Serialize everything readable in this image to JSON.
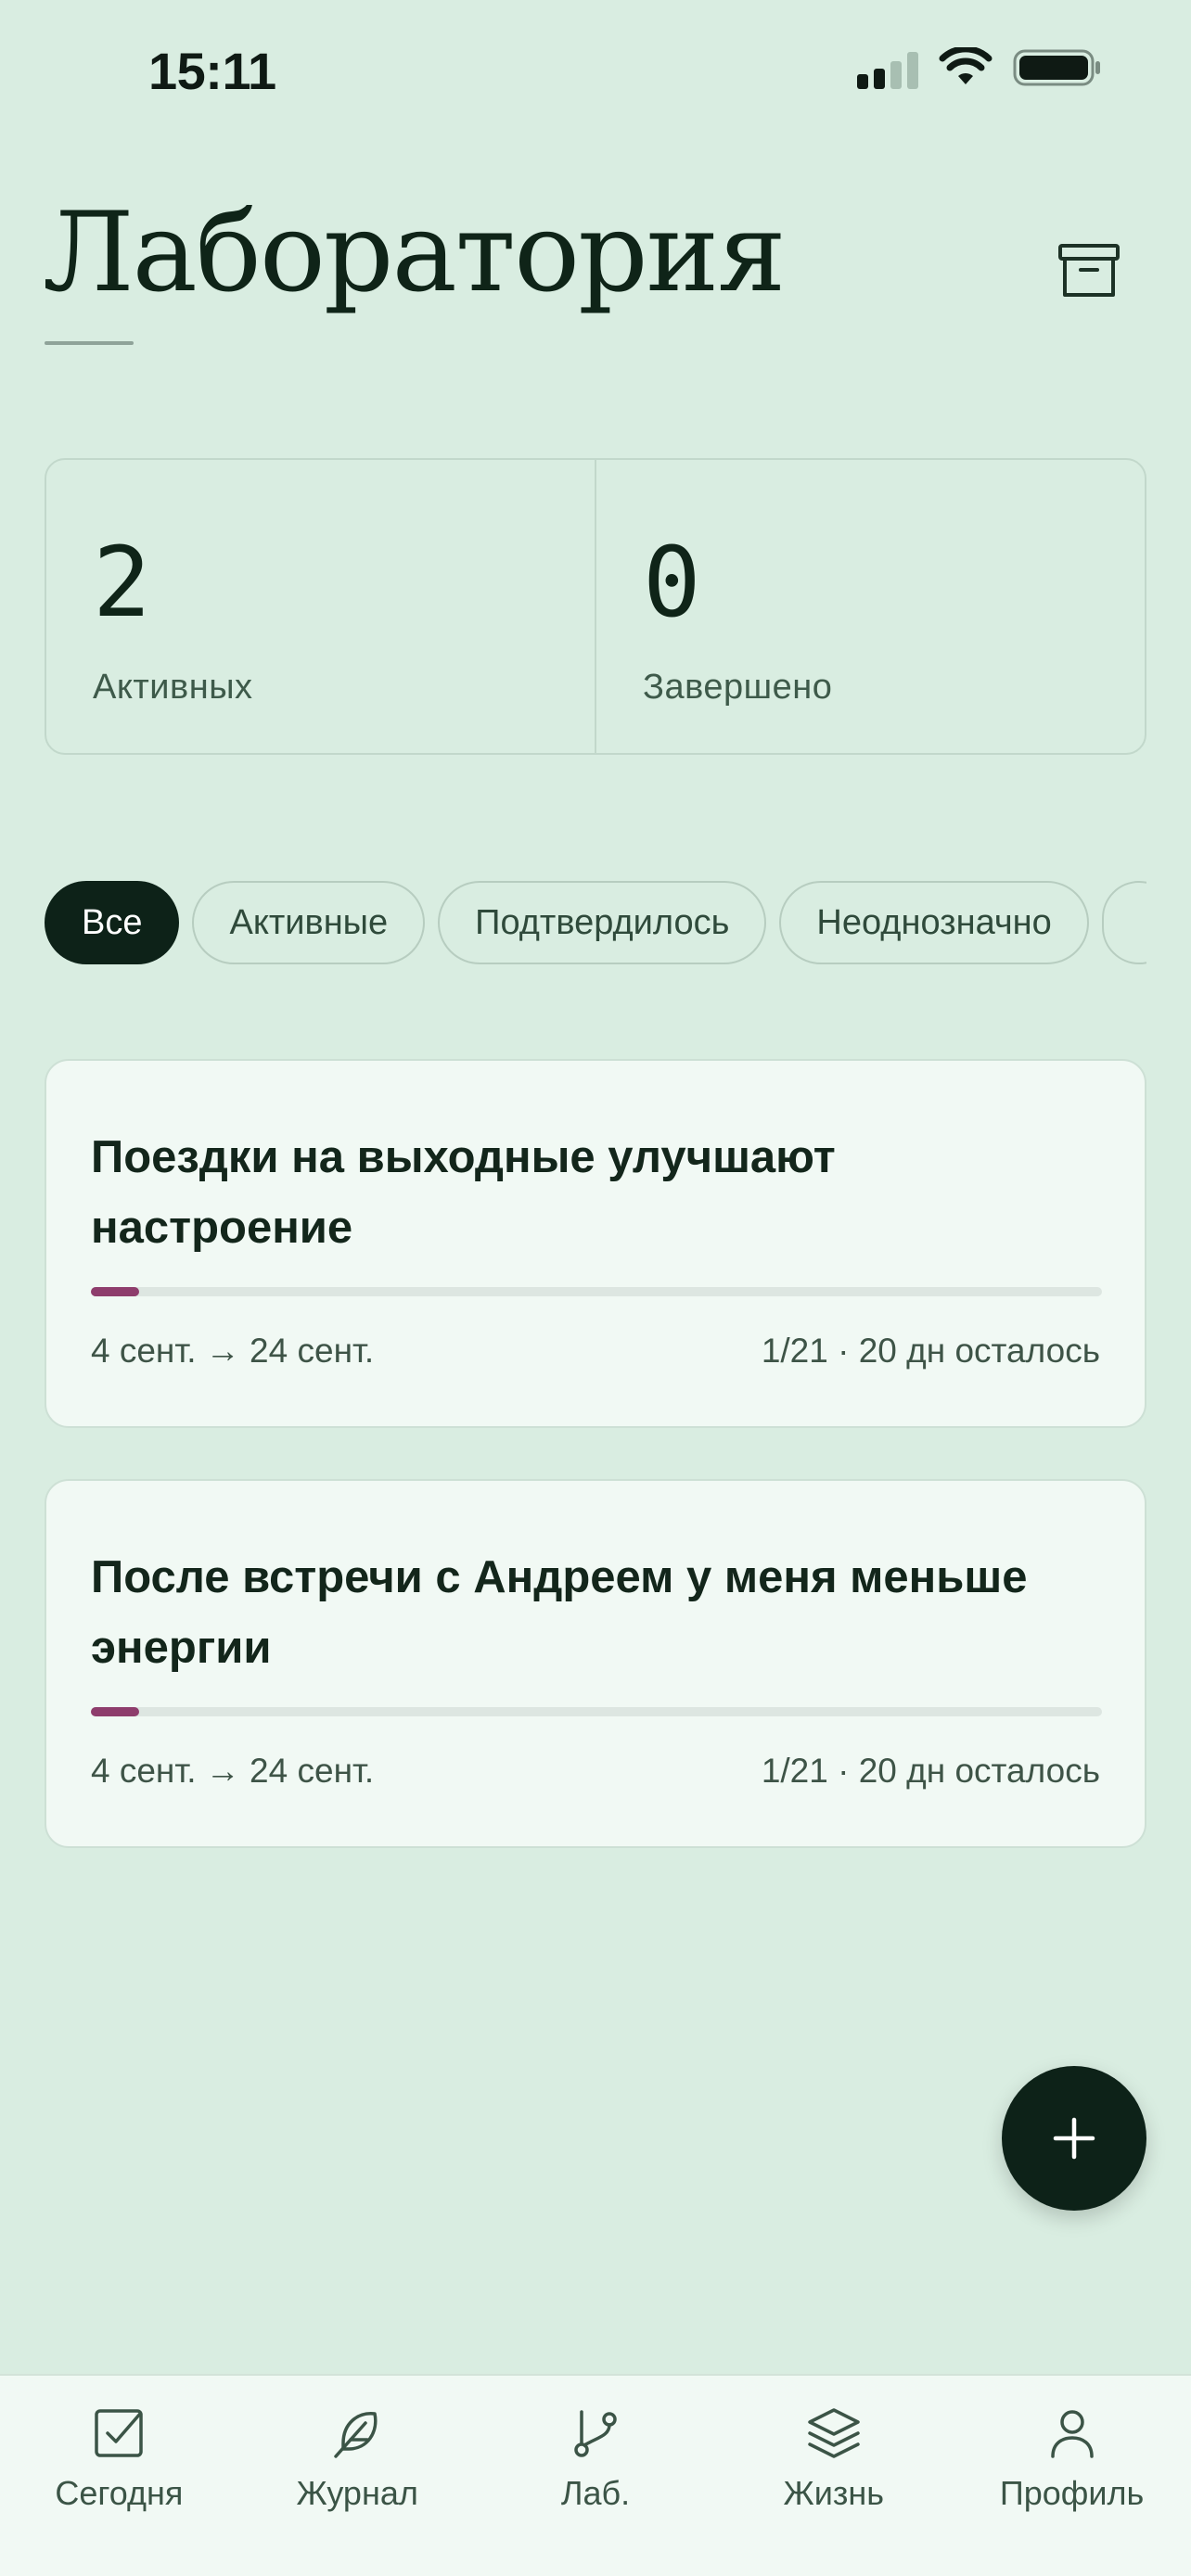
{
  "status_bar": {
    "time": "15:11"
  },
  "header": {
    "title": "Лаборатория",
    "archive_icon": "archive-icon"
  },
  "stats": [
    {
      "value": "2",
      "label": "Активных"
    },
    {
      "value": "0",
      "label": "Завершено"
    }
  ],
  "filters": [
    {
      "label": "Все",
      "active": true
    },
    {
      "label": "Активные"
    },
    {
      "label": "Подтвердилось"
    },
    {
      "label": "Неоднозначно"
    },
    {
      "label": ""
    }
  ],
  "experiments": [
    {
      "title": "Поездки на выходные улучшают настроение",
      "dates": "4 сент. → 24 сент.",
      "status": "1/21 · 20 дн осталось",
      "progress": 0.0476
    },
    {
      "title": "После встречи с Андреем у меня меньше энергии",
      "dates": "4 сент. → 24 сент.",
      "status": "1/21 · 20 дн осталось",
      "progress": 0.0476
    }
  ],
  "fab": {
    "icon": "plus-icon"
  },
  "nav": [
    {
      "label": "Сегодня",
      "icon": "checkbox-icon"
    },
    {
      "label": "Журнал",
      "icon": "feather-icon"
    },
    {
      "label": "Лаб.",
      "icon": "branch-icon"
    },
    {
      "label": "Жизнь",
      "icon": "layers-icon"
    },
    {
      "label": "Профиль",
      "icon": "user-icon"
    }
  ],
  "colors": {
    "background": "#d9ede1",
    "accent": "#8e3d6c",
    "dark": "#0d2218",
    "card": "#f1f9f4"
  }
}
